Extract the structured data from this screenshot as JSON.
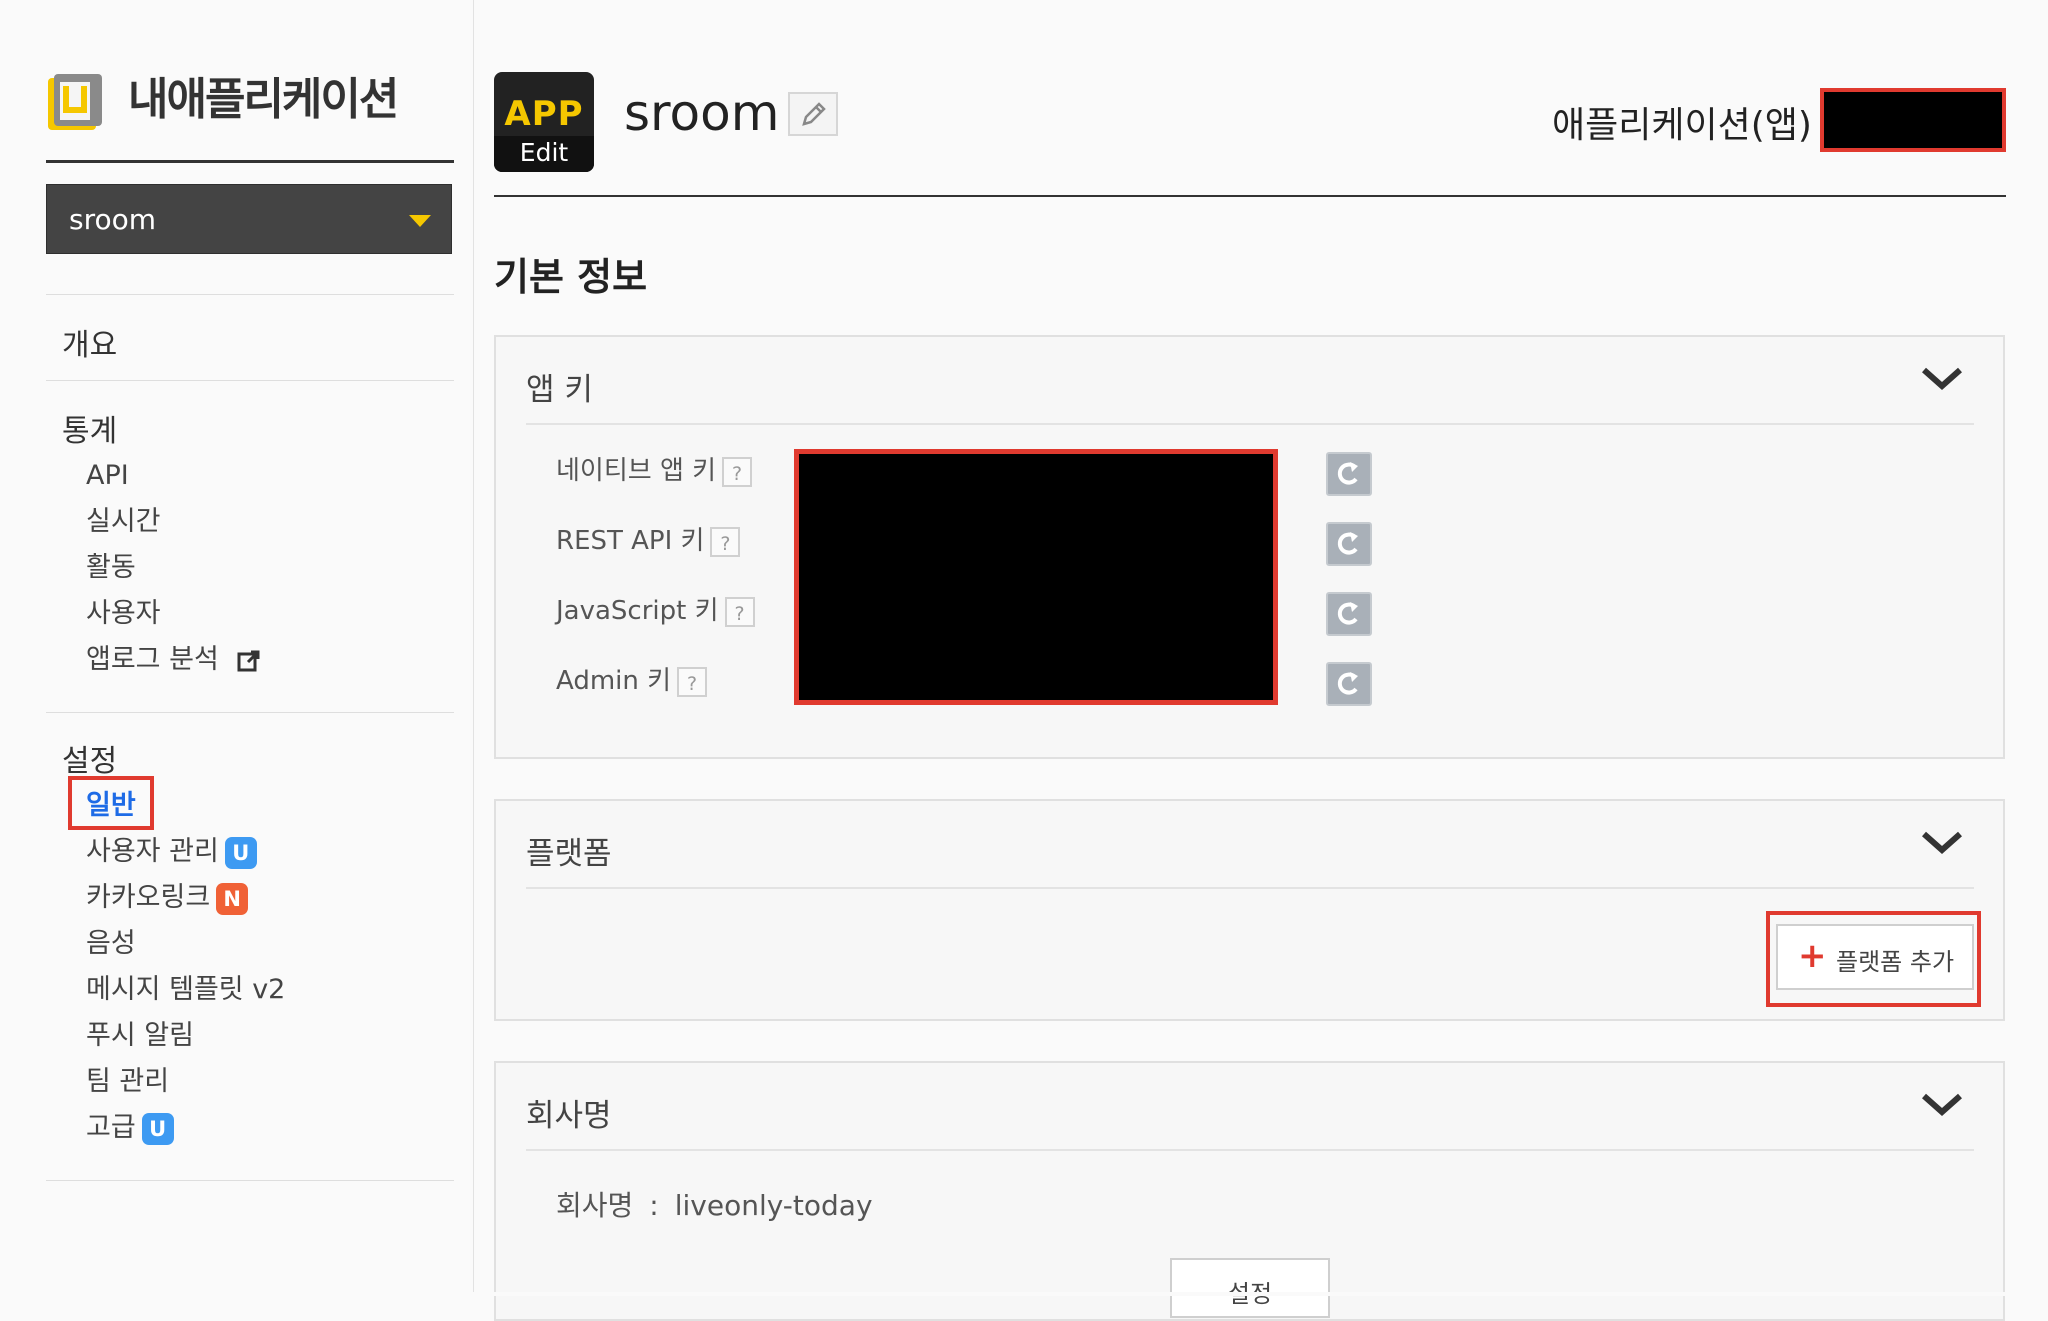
{
  "sidebar": {
    "logo_text": "내애플리케이션",
    "app_select": "sroom",
    "overview": "개요",
    "stats": {
      "heading": "통계",
      "items": [
        "API",
        "실시간",
        "활동",
        "사용자",
        "앱로그 분석"
      ]
    },
    "settings": {
      "heading": "설정",
      "items": [
        {
          "label": "일반",
          "active": true
        },
        {
          "label": "사용자 관리",
          "badge": "U"
        },
        {
          "label": "카카오링크",
          "badge": "N"
        },
        {
          "label": "음성"
        },
        {
          "label": "메시지 템플릿 v2"
        },
        {
          "label": "푸시 알림"
        },
        {
          "label": "팀 관리"
        },
        {
          "label": "고급",
          "badge": "U"
        }
      ]
    }
  },
  "header": {
    "app_tile_top": "APP",
    "app_tile_bottom": "Edit",
    "app_name": "sroom",
    "app_id_label": "애플리케이션(앱)"
  },
  "main": {
    "section_title": "기본 정보",
    "app_keys": {
      "title": "앱 키",
      "rows": [
        {
          "label": "네이티브 앱 키"
        },
        {
          "label": "REST API 키"
        },
        {
          "label": "JavaScript 키"
        },
        {
          "label": "Admin 키"
        }
      ],
      "help": "?"
    },
    "platform": {
      "title": "플랫폼",
      "add_plus": "+",
      "add_label": "플랫폼 추가"
    },
    "company": {
      "title": "회사명",
      "label": "회사명",
      "separator": ":",
      "value": "liveonly-today",
      "button_label": "설정"
    }
  },
  "colors": {
    "highlight": "#e03a2f",
    "active_link": "#1e6be6",
    "badge_u": "#3d9af2",
    "badge_n": "#f06136",
    "dropdown_bg": "#444444",
    "caret": "#f5c700"
  }
}
